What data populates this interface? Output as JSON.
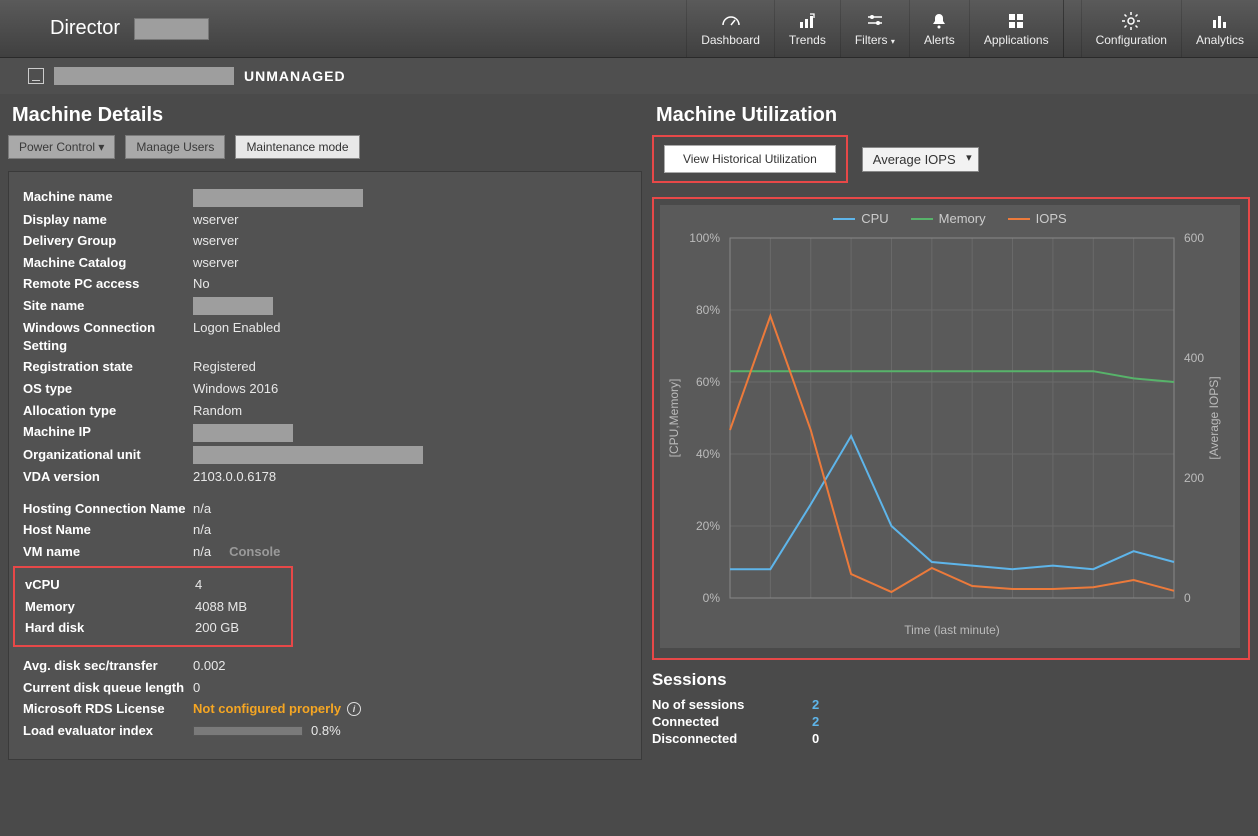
{
  "brand": {
    "title": "Director"
  },
  "nav": {
    "items": [
      {
        "label": "Dashboard"
      },
      {
        "label": "Trends"
      },
      {
        "label": "Filters"
      },
      {
        "label": "Alerts"
      },
      {
        "label": "Applications"
      },
      {
        "label": "Configuration"
      },
      {
        "label": "Analytics"
      }
    ]
  },
  "subheader": {
    "status": "UNMANAGED"
  },
  "left": {
    "title": "Machine Details",
    "buttons": {
      "power": "Power Control ▾",
      "manage_users": "Manage Users",
      "maintenance": "Maintenance mode"
    },
    "rows": {
      "machine_name": {
        "label": "Machine name",
        "value": ""
      },
      "display_name": {
        "label": "Display name",
        "value": "wserver"
      },
      "delivery_group": {
        "label": "Delivery Group",
        "value": "wserver"
      },
      "machine_catalog": {
        "label": "Machine Catalog",
        "value": "wserver"
      },
      "remote_pc": {
        "label": "Remote PC access",
        "value": "No"
      },
      "site_name": {
        "label": "Site name",
        "value": ""
      },
      "win_conn": {
        "label": "Windows Connection Setting",
        "value": "Logon Enabled"
      },
      "reg_state": {
        "label": "Registration state",
        "value": "Registered"
      },
      "os_type": {
        "label": "OS type",
        "value": "Windows 2016"
      },
      "alloc_type": {
        "label": "Allocation type",
        "value": "Random"
      },
      "machine_ip": {
        "label": "Machine IP",
        "value": ""
      },
      "org_unit": {
        "label": "Organizational unit",
        "value": ""
      },
      "vda": {
        "label": "VDA version",
        "value": "2103.0.0.6178"
      },
      "host_conn": {
        "label": "Hosting Connection Name",
        "value": "n/a"
      },
      "host_name": {
        "label": "Host Name",
        "value": "n/a"
      },
      "vm_name": {
        "label": "VM name",
        "value": "n/a",
        "console": "Console"
      },
      "vcpu": {
        "label": "vCPU",
        "value": "4"
      },
      "memory": {
        "label": "Memory",
        "value": "4088 MB"
      },
      "hard_disk": {
        "label": "Hard disk",
        "value": "200 GB"
      },
      "avg_disk": {
        "label": "Avg. disk sec/transfer",
        "value": "0.002"
      },
      "queue": {
        "label": "Current disk queue length",
        "value": "0"
      },
      "rds": {
        "label": "Microsoft RDS License",
        "value": "Not configured properly"
      },
      "load": {
        "label": "Load evaluator index",
        "value": "0.8%"
      }
    }
  },
  "right": {
    "title": "Machine Utilization",
    "view_btn": "View Historical Utilization",
    "select_label": "Average IOPS",
    "legend": {
      "cpu": "CPU",
      "memory": "Memory",
      "iops": "IOPS"
    },
    "ylabel_left": "[CPU,Memory]",
    "ylabel_right": "[Average IOPS]",
    "xlabel": "Time (last minute)"
  },
  "sessions": {
    "title": "Sessions",
    "rows": {
      "num": {
        "label": "No of sessions",
        "value": "2"
      },
      "connected": {
        "label": "Connected",
        "value": "2"
      },
      "disconnected": {
        "label": "Disconnected",
        "value": "0"
      }
    }
  },
  "chart_data": {
    "type": "line",
    "title": "",
    "xlabel": "Time (last minute)",
    "ylabel": "[CPU,Memory]",
    "y2label": "[Average IOPS]",
    "ylim": [
      0,
      100
    ],
    "y2lim": [
      0,
      600
    ],
    "x": [
      0,
      1,
      2,
      3,
      4,
      5,
      6,
      7,
      8,
      9,
      10,
      11
    ],
    "series": [
      {
        "name": "CPU",
        "color": "#5eb5ea",
        "axis": "left",
        "values": [
          8,
          8,
          26,
          45,
          20,
          10,
          9,
          8,
          9,
          8,
          13,
          10
        ]
      },
      {
        "name": "Memory",
        "color": "#57b36a",
        "axis": "left",
        "values": [
          63,
          63,
          63,
          63,
          63,
          63,
          63,
          63,
          63,
          63,
          61,
          60
        ]
      },
      {
        "name": "IOPS",
        "color": "#ec7a3b",
        "axis": "right",
        "values": [
          280,
          470,
          280,
          40,
          10,
          50,
          20,
          15,
          15,
          18,
          30,
          12
        ]
      }
    ],
    "y_ticks": [
      0,
      20,
      40,
      60,
      80,
      100
    ],
    "y2_ticks": [
      0,
      200,
      400,
      600
    ]
  }
}
